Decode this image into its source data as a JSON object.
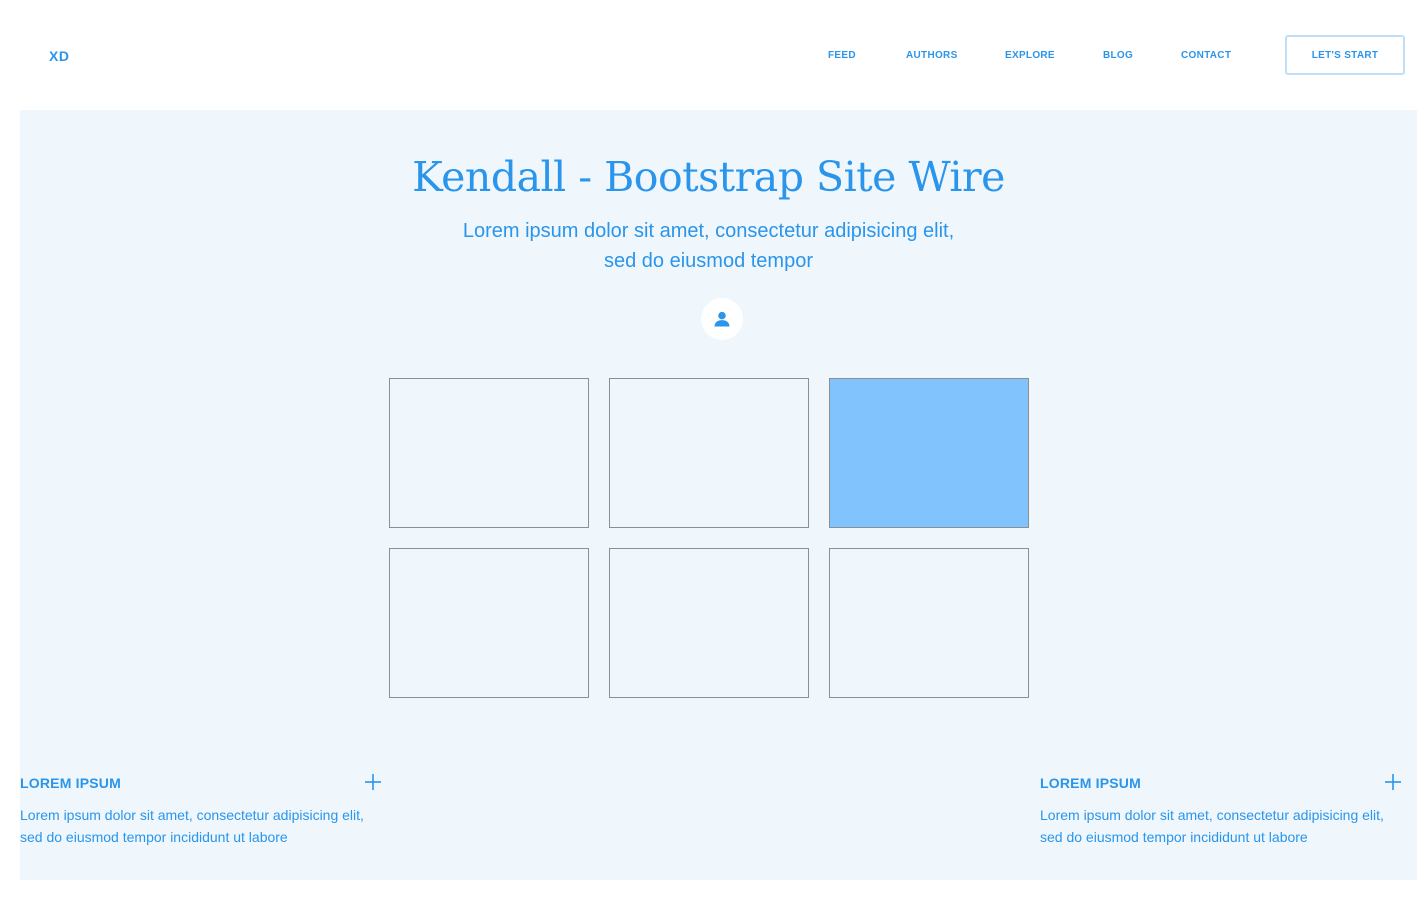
{
  "header": {
    "logo": "XD",
    "nav": [
      "FEED",
      "AUTHORS",
      "EXPLORE",
      "BLOG",
      "CONTACT"
    ],
    "cta_label": "LET'S START"
  },
  "hero": {
    "title": "Kendall - Bootstrap Site Wire",
    "subtitle_line1": "Lorem ipsum dolor sit amet, consectetur adipisicing elit,",
    "subtitle_line2": "sed do eiusmod tempor",
    "avatar_icon": "user-icon"
  },
  "gallery": {
    "active_index": 2,
    "count": 6
  },
  "features": [
    {
      "title": "LOREM IPSUM",
      "text_line1": "Lorem ipsum dolor sit amet, consectetur adipisicing elit,",
      "text_line2": "sed do eiusmod tempor incididunt ut labore",
      "icon": "plus-icon"
    },
    {
      "title": "LOREM IPSUM",
      "text_line1": "Lorem ipsum dolor sit amet, consectetur adipisicing elit,",
      "text_line2": "sed do eiusmod tempor incididunt ut labore",
      "icon": "plus-icon"
    }
  ],
  "colors": {
    "accent": "#2a95ea",
    "panel_bg": "#eff7fd",
    "active_tile": "#80c3fd",
    "tile_border": "#8e8e8e"
  }
}
